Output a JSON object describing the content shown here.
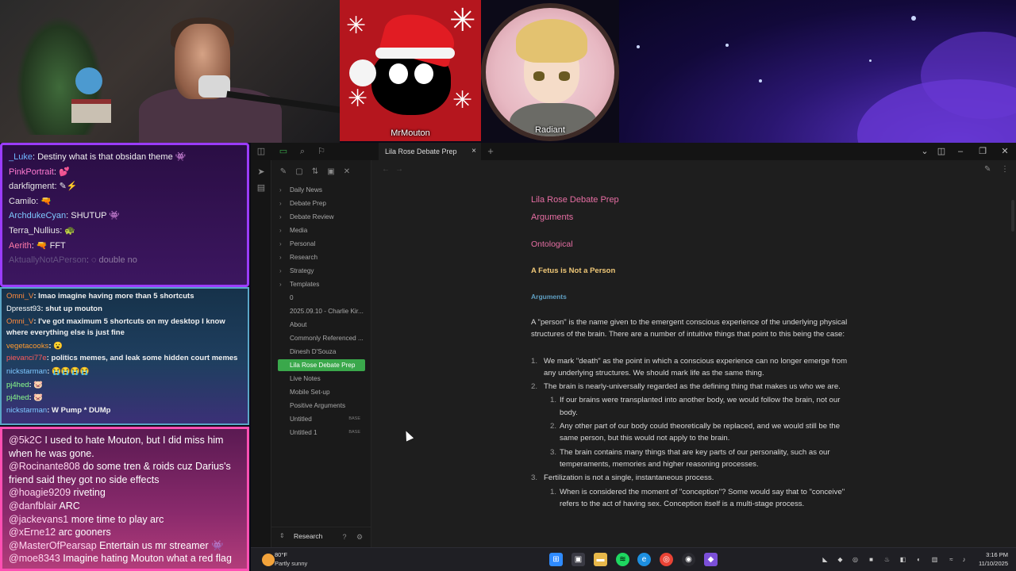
{
  "overlay": {
    "avatar1_name": "MrMouton",
    "avatar2_name": "Radiant"
  },
  "chat_top": [
    {
      "user": "_Luke",
      "color": "#6fb7ff",
      "text": ": Destiny what is that obsidan theme 👾"
    },
    {
      "user": "PinkPortrait",
      "color": "#ff7ad1",
      "text": ": 💕"
    },
    {
      "user": "darkfigment",
      "color": "#e6e6e6",
      "text": ": ✎⚡"
    },
    {
      "user": "Camilo",
      "color": "#e6e6e6",
      "text": ": 🔫"
    },
    {
      "user": "ArchdukeCyan",
      "color": "#7ec8ff",
      "text": ": SHUTUP 👾"
    },
    {
      "user": "Terra_Nullius",
      "color": "#e6e6e6",
      "text": ": 🐢"
    },
    {
      "user": "Aerith",
      "color": "#ff7aa8",
      "text": ": 🔫 FFT"
    },
    {
      "user": "AktuallyNotAPerson",
      "color": "#9a9ab0",
      "text": ": ◌ double no"
    }
  ],
  "chat_mid": [
    {
      "user": "Omni_V",
      "color": "#ff8a3d",
      "text": ": lmao imagine having more than 5 shortcuts"
    },
    {
      "user": "Dpresst93",
      "color": "#ffffff",
      "text": ": shut up mouton"
    },
    {
      "user": "Omni_V",
      "color": "#ff8a3d",
      "text": ": I've got maximum 5 shortcuts on my desktop I know where everything else is just fine"
    },
    {
      "user": "vegetacooks",
      "color": "#ff9a2e",
      "text": ": 😮"
    },
    {
      "user": "pievanci77e",
      "color": "#ff5a5a",
      "text": ": politics memes, and leak some hidden court memes"
    },
    {
      "user": "nickstarman",
      "color": "#7ec8ff",
      "text": ": 😭😭😭😭"
    },
    {
      "user": "pj4hed",
      "color": "#8bff8b",
      "text": ": 🐷"
    },
    {
      "user": "pj4hed",
      "color": "#8bff8b",
      "text": ": 🐷"
    },
    {
      "user": "nickstarman",
      "color": "#7ec8ff",
      "text": ": W Pump * DUMp"
    }
  ],
  "chat_bottom": [
    {
      "user": "@5k2C",
      "text": " I used to hate Mouton, but I did miss him when he was gone."
    },
    {
      "user": "@Rocinante808",
      "text": " do some tren & roids cuz Darius's friend said they got no side effects"
    },
    {
      "user": "@hoagie9209",
      "text": " riveting"
    },
    {
      "user": "@danfblair",
      "text": " ARC"
    },
    {
      "user": "@jackevans1",
      "text": " more time to play arc"
    },
    {
      "user": "@xErne12",
      "text": " arc gooners"
    },
    {
      "user": "@MasterOfPearsap",
      "text": " Entertain us mr streamer 👾"
    },
    {
      "user": "@moe8343",
      "text": " Imagine hating Mouton what a red flag"
    }
  ],
  "obsidian": {
    "tab_title": "Lila Rose Debate Prep",
    "tab_close": "×",
    "tab_new": "+",
    "vault_name": "Research",
    "tree": [
      {
        "label": "Daily News",
        "folder": true
      },
      {
        "label": "Debate Prep",
        "folder": true
      },
      {
        "label": "Debate Review",
        "folder": true
      },
      {
        "label": "Media",
        "folder": true
      },
      {
        "label": "Personal",
        "folder": true
      },
      {
        "label": "Research",
        "folder": true
      },
      {
        "label": "Strategy",
        "folder": true
      },
      {
        "label": "Templates",
        "folder": true
      },
      {
        "label": "0",
        "folder": false
      },
      {
        "label": "2025.09.10 - Charlie Kir...",
        "folder": false
      },
      {
        "label": "About",
        "folder": false
      },
      {
        "label": "Commonly Referenced ...",
        "folder": false
      },
      {
        "label": "Dinesh D'Souza",
        "folder": false
      },
      {
        "label": "Lila Rose Debate Prep",
        "folder": false,
        "active": true
      },
      {
        "label": "Live Notes",
        "folder": false
      },
      {
        "label": "Mobile Set-up",
        "folder": false
      },
      {
        "label": "Positive Arguments",
        "folder": false
      },
      {
        "label": "Untitled",
        "folder": false,
        "badge": "BASE"
      },
      {
        "label": "Untitled 1",
        "folder": false,
        "badge": "BASE"
      }
    ],
    "note": {
      "title": "Lila Rose Debate Prep",
      "h1": "Arguments",
      "h2": "Ontological",
      "h3": "A Fetus is Not a Person",
      "h4": "Arguments",
      "intro": "A \"person\" is the name given to the emergent conscious experience of the underlying physical structures of the brain. There are a number of intuitive things that point to this being the case:",
      "items": [
        {
          "level": 1,
          "num": "1.",
          "text": "We mark \"death\" as the point in which a conscious experience can no longer emerge from any underlying structures. We should mark life as the same thing."
        },
        {
          "level": 1,
          "num": "2.",
          "text": "The brain is nearly-universally regarded as the defining thing that makes us who we are."
        },
        {
          "level": 2,
          "num": "1.",
          "text": "If our brains were transplanted into another body, we would follow the brain, not our body."
        },
        {
          "level": 2,
          "num": "2.",
          "text": "Any other part of our body could theoretically be replaced, and we would still be the same person, but this would not apply to the brain."
        },
        {
          "level": 2,
          "num": "3.",
          "text": "The brain contains many things that are key parts of our personality, such as our temperaments, memories and higher reasoning processes."
        },
        {
          "level": 1,
          "num": "3.",
          "text": "Fertilization is not a single, instantaneous process."
        },
        {
          "level": 2,
          "num": "1.",
          "text": "When is considered the moment of \"conception\"? Some would say that to \"conceive\" refers to the act of having sex. Conception itself is a multi-stage process."
        }
      ]
    }
  },
  "taskbar": {
    "temp": "80°F",
    "weather": "Partly sunny",
    "time": "3:16 PM",
    "date": "11/10/2025"
  }
}
